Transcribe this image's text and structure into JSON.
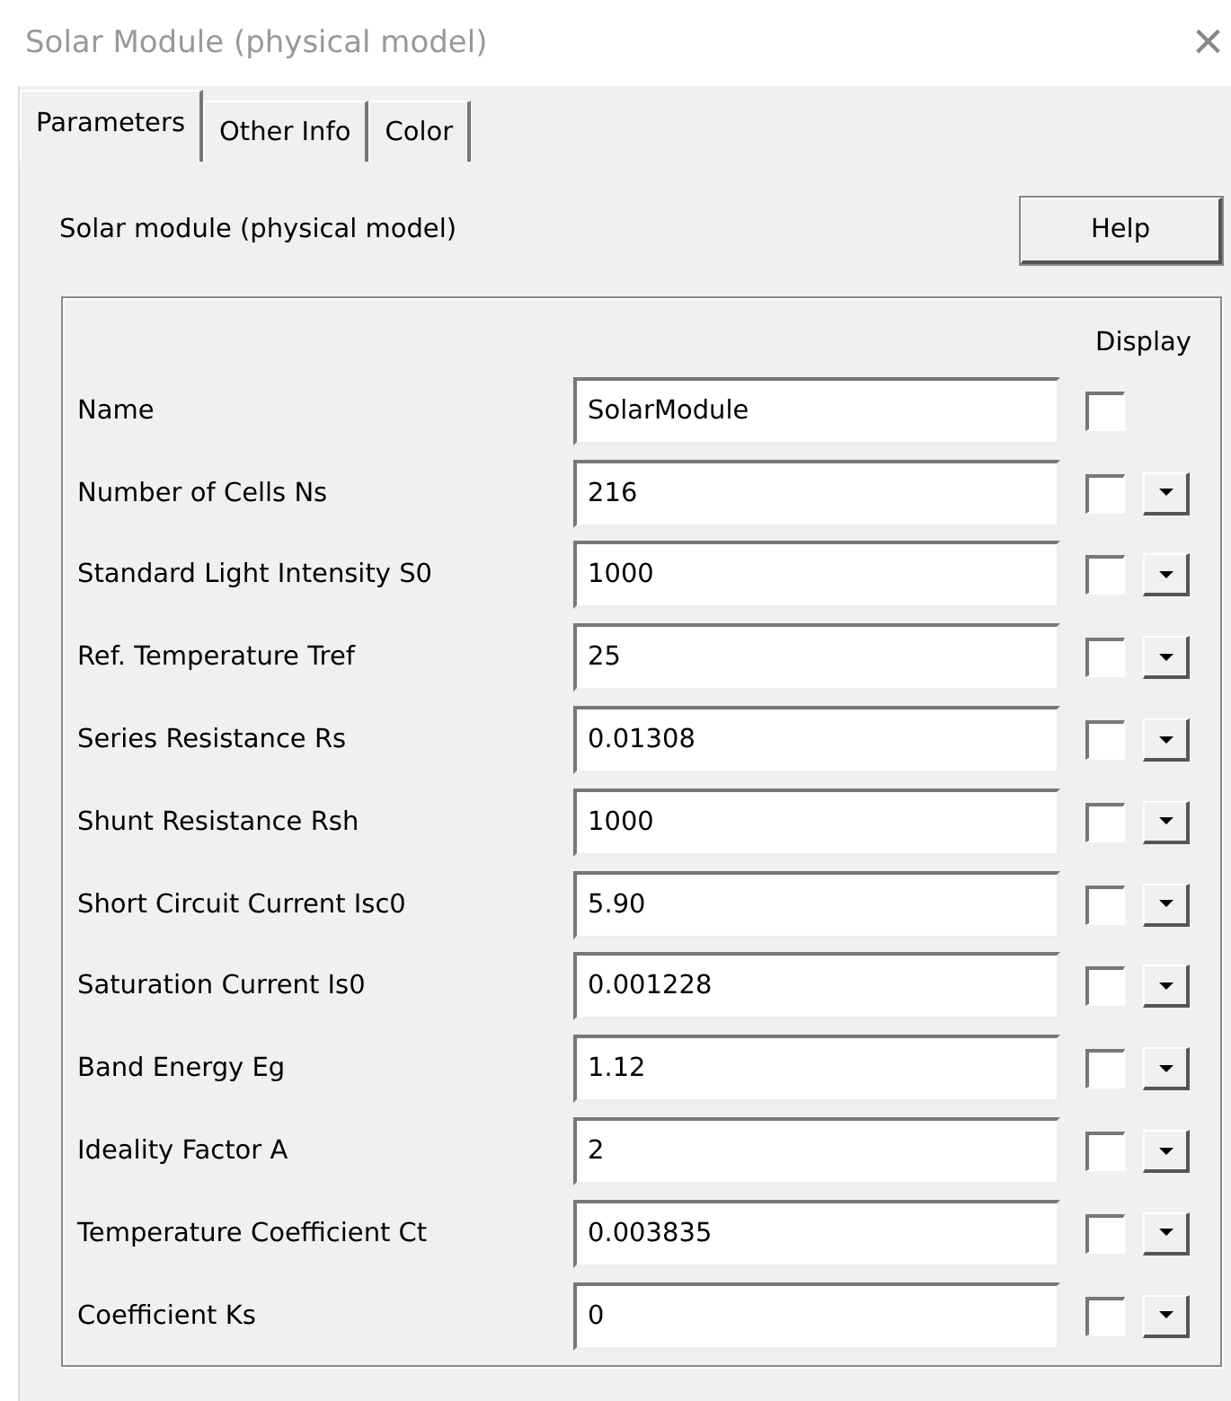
{
  "window": {
    "title": "Solar Module (physical model)",
    "close": "×"
  },
  "tabs": [
    {
      "label": "Parameters",
      "selected": true
    },
    {
      "label": "Other Info",
      "selected": false
    },
    {
      "label": "Color",
      "selected": false
    }
  ],
  "header": {
    "label": "Solar module (physical model)",
    "help_button": "Help"
  },
  "display_heading": "Display",
  "parameters": [
    {
      "label": "Name",
      "value": "SolarModule",
      "display": false,
      "has_dropdown": false
    },
    {
      "label": "Number of Cells Ns",
      "value": "216",
      "display": false,
      "has_dropdown": true
    },
    {
      "label": "Standard Light Intensity S0",
      "value": "1000",
      "display": false,
      "has_dropdown": true
    },
    {
      "label": "Ref. Temperature Tref",
      "value": "25",
      "display": false,
      "has_dropdown": true
    },
    {
      "label": "Series Resistance Rs",
      "value": "0.01308",
      "display": false,
      "has_dropdown": true
    },
    {
      "label": "Shunt Resistance Rsh",
      "value": "1000",
      "display": false,
      "has_dropdown": true
    },
    {
      "label": "Short Circuit Current Isc0",
      "value": "5.90",
      "display": false,
      "has_dropdown": true
    },
    {
      "label": "Saturation Current Is0",
      "value": "0.001228",
      "display": false,
      "has_dropdown": true
    },
    {
      "label": "Band Energy Eg",
      "value": "1.12",
      "display": false,
      "has_dropdown": true
    },
    {
      "label": "Ideality Factor A",
      "value": "2",
      "display": false,
      "has_dropdown": true
    },
    {
      "label": "Temperature Coefficient Ct",
      "value": "0.003835",
      "display": false,
      "has_dropdown": true
    },
    {
      "label": "Coefficient Ks",
      "value": "0",
      "display": false,
      "has_dropdown": true
    }
  ]
}
